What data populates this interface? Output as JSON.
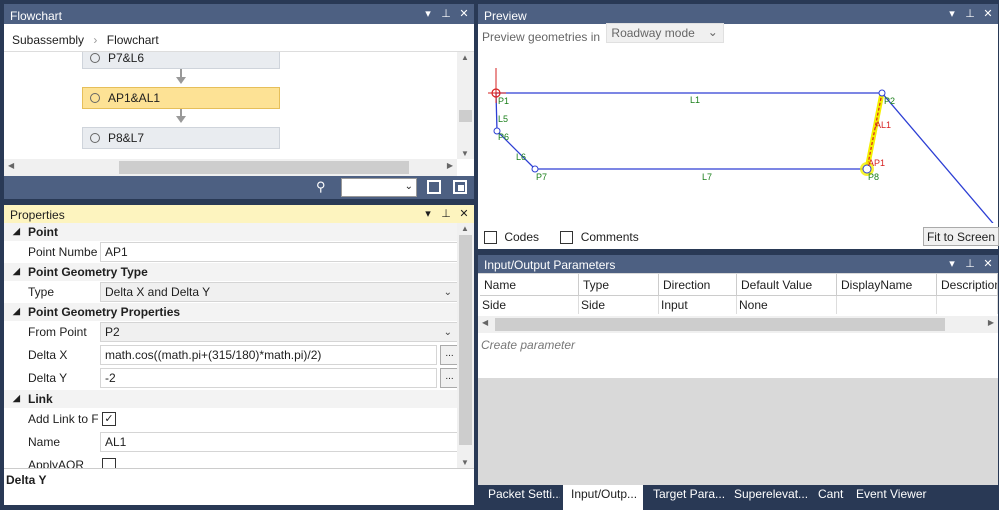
{
  "flowchart": {
    "title": "Flowchart",
    "breadcrumb": [
      "Subassembly",
      "Flowchart"
    ],
    "nodes": [
      "P7&L6",
      "AP1&AL1",
      "P8&L7"
    ],
    "selected_node": "AP1&AL1"
  },
  "properties": {
    "title": "Properties",
    "sections": {
      "point": "Point",
      "geometry_type": "Point Geometry Type",
      "geometry_props": "Point Geometry Properties",
      "link": "Link"
    },
    "rows": {
      "point_number": {
        "label": "Point Numbe",
        "value": "AP1"
      },
      "type": {
        "label": "Type",
        "value": "Delta X and Delta Y"
      },
      "from_point": {
        "label": "From Point",
        "value": "P2"
      },
      "delta_x": {
        "label": "Delta X",
        "value": "math.cos((math.pi+(315/180)*math.pi)/2)"
      },
      "delta_y": {
        "label": "Delta Y",
        "value": "-2"
      },
      "add_link": {
        "label": "Add Link to F",
        "checked": true
      },
      "name": {
        "label": "Name",
        "value": "AL1"
      },
      "apply_aor": {
        "label": "ApplyAOR",
        "checked": false
      }
    },
    "description": "Delta Y",
    "ellipsis": "..."
  },
  "preview": {
    "title": "Preview",
    "geometries_label": "Preview geometries in",
    "mode": "Roadway mode",
    "codes_label": "Codes",
    "comments_label": "Comments",
    "fit_button": "Fit to Screen",
    "labels": {
      "P1": "P1",
      "P2": "P2",
      "P6": "P6",
      "P7": "P7",
      "P8": "P8",
      "L1": "L1",
      "L5": "L5",
      "L6": "L6",
      "L7": "L7",
      "AL1": "AL1",
      "AP1": "AP1"
    }
  },
  "io": {
    "title": "Input/Output Parameters",
    "columns": [
      "Name",
      "Type",
      "Direction",
      "Default Value",
      "DisplayName",
      "Description"
    ],
    "rows": [
      [
        "Side",
        "Side",
        "Input",
        "None",
        "",
        ""
      ]
    ],
    "create_placeholder": "Create parameter"
  },
  "tabs": [
    "Packet Setti...",
    "Input/Outp...",
    "Target Para...",
    "Superelevat...",
    "Cant",
    "Event Viewer"
  ],
  "active_tab": "Input/Outp...",
  "icons": {
    "dropdown": "chevron-down-icon",
    "pin": "pin-icon",
    "close": "close-icon",
    "search": "search-icon"
  },
  "colors": {
    "titlebar": "#4d6082",
    "active_titlebar": "#fdf4bf",
    "selected_node": "#fde295",
    "geometry_blue": "#2d3fd4",
    "label_green": "#1a7f1a",
    "link_red": "#d62020",
    "highlight_yellow": "#f5f000"
  }
}
